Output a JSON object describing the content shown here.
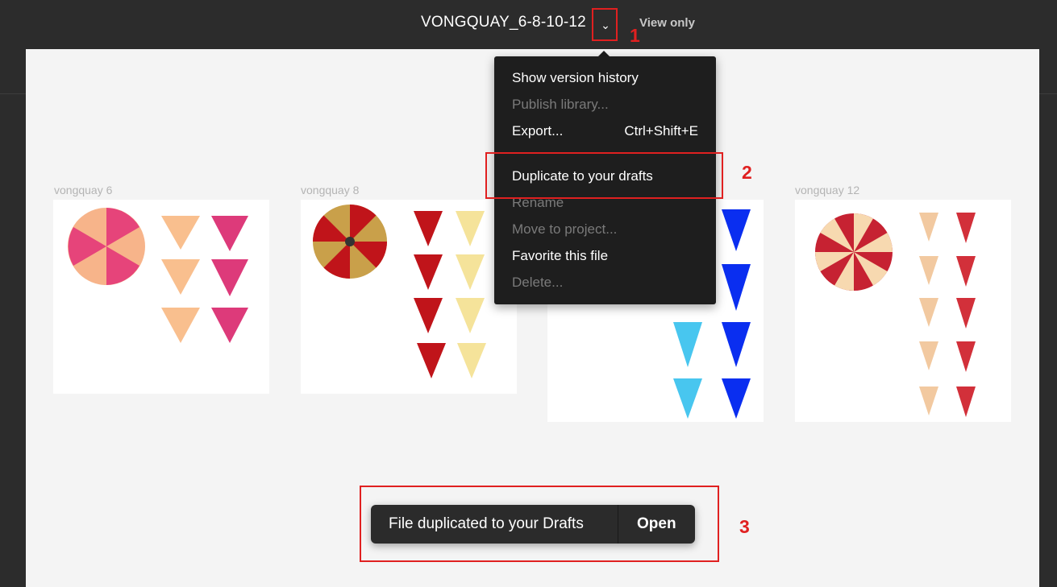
{
  "header": {
    "file_title": "VONGQUAY_6-8-10-12",
    "view_only": "View only"
  },
  "frames": [
    {
      "label": "vongquay 6"
    },
    {
      "label": "vongquay 8"
    },
    {
      "label": "vongquay 12"
    }
  ],
  "menu": {
    "items": [
      {
        "label": "Show version history",
        "enabled": true,
        "shortcut": ""
      },
      {
        "label": "Publish library...",
        "enabled": false,
        "shortcut": ""
      },
      {
        "label": "Export...",
        "enabled": true,
        "shortcut": "Ctrl+Shift+E"
      },
      {
        "label": "Duplicate to your drafts",
        "enabled": true,
        "shortcut": ""
      },
      {
        "label": "Rename",
        "enabled": false,
        "shortcut": ""
      },
      {
        "label": "Move to project...",
        "enabled": false,
        "shortcut": ""
      },
      {
        "label": "Favorite this file",
        "enabled": true,
        "shortcut": ""
      },
      {
        "label": "Delete...",
        "enabled": false,
        "shortcut": ""
      }
    ]
  },
  "annotations": {
    "step1": "1",
    "step2": "2",
    "step3": "3",
    "color": "#e02020"
  },
  "toast": {
    "message": "File duplicated to your Drafts",
    "action": "Open"
  },
  "colors": {
    "topbar": "#2c2c2c",
    "canvas": "#f4f4f4",
    "menu_bg": "#1e1e1e",
    "disabled_text": "#7a7a7a",
    "highlight_red": "#e02020"
  },
  "icons": {
    "title_dropdown": "chevron-down-icon"
  }
}
